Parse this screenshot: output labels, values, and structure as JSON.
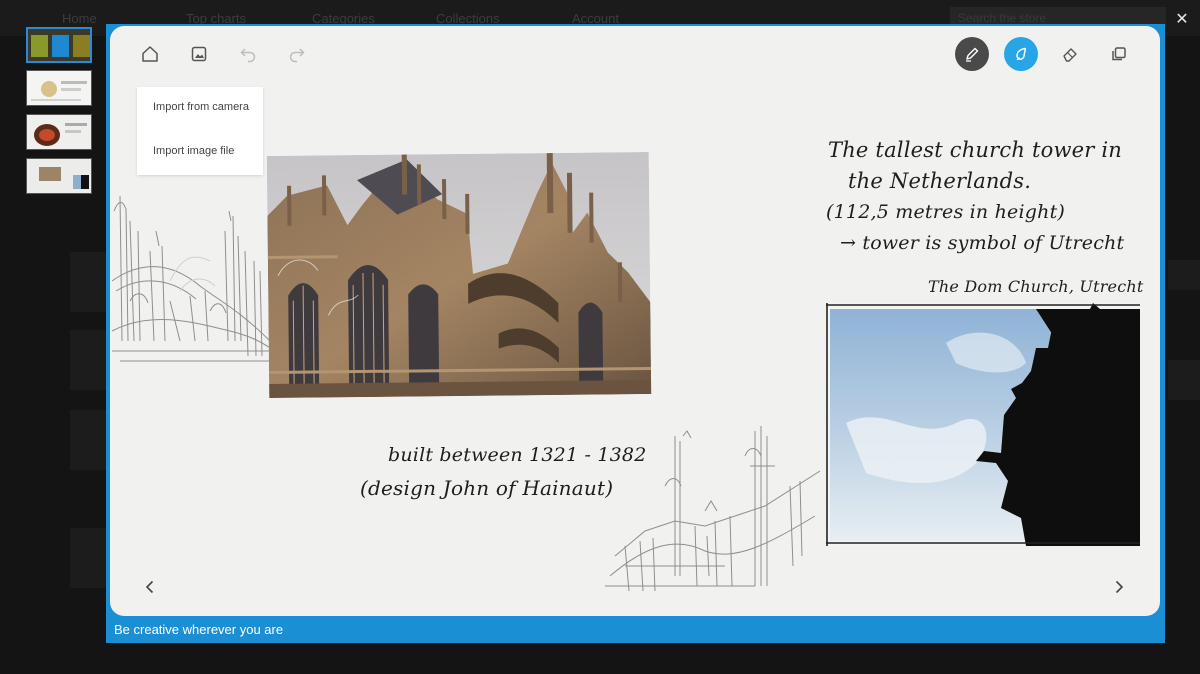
{
  "background_nav": {
    "tabs": [
      "Home",
      "Top charts",
      "Categories",
      "Collections",
      "Account"
    ],
    "search_placeholder": "Search the store"
  },
  "toolbar": {
    "home_icon": "home-icon",
    "insert_image_icon": "image-icon",
    "undo_icon": "undo-icon",
    "redo_icon": "redo-icon",
    "pen_icon": "pen-icon",
    "ink_icon": "ink-drop-icon",
    "eraser_icon": "eraser-icon",
    "fullscreen_icon": "resize-icon"
  },
  "import_menu": {
    "camera_label": "Import from camera",
    "file_label": "Import image file"
  },
  "canvas_notes": {
    "note_line1": "The tallest church tower in",
    "note_line2": "the Netherlands.",
    "note_line3": "(112,5 metres in height)",
    "note_line4": "→ tower is symbol of Utrecht",
    "church_caption": "The Dom Church, Utrecht",
    "built_line1": "built between 1321 - 1382",
    "built_line2": "(design John of Hainaut)"
  },
  "navigation": {
    "prev_icon": "chevron-left-icon",
    "next_icon": "chevron-right-icon"
  },
  "caption": "Be creative wherever you are",
  "colors": {
    "accent": "#1b8fd4",
    "ink_active": "#28a5e6",
    "pen_active": "#4a4a4a",
    "canvas": "#f1f1ef"
  }
}
